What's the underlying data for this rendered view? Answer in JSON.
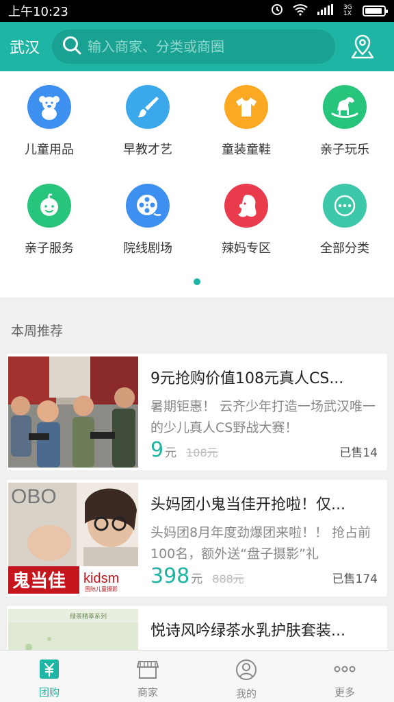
{
  "status_bar": {
    "time": "上午10:23",
    "network": "3G 1X"
  },
  "header": {
    "city": "武汉",
    "search_placeholder": "输入商家、分类或商圈",
    "location_icon": "location-pin-icon"
  },
  "categories": [
    {
      "label": "儿童用品",
      "icon": "teddy-bear-icon",
      "color": "#3d8ff0"
    },
    {
      "label": "早教才艺",
      "icon": "paintbrush-icon",
      "color": "#3aa8ea"
    },
    {
      "label": "童装童鞋",
      "icon": "shirt-icon",
      "color": "#fba823"
    },
    {
      "label": "亲子玩乐",
      "icon": "rocking-horse-icon",
      "color": "#27c47c"
    },
    {
      "label": "亲子服务",
      "icon": "baby-face-icon",
      "color": "#27c47c"
    },
    {
      "label": "院线剧场",
      "icon": "film-reel-icon",
      "color": "#3d8ff0"
    },
    {
      "label": "辣妈专区",
      "icon": "woman-profile-icon",
      "color": "#ea3b4d"
    },
    {
      "label": "全部分类",
      "icon": "more-dots-icon",
      "color": "#3cc7a8"
    }
  ],
  "section_title": "本周推荐",
  "deals": [
    {
      "title": "9元抢购价值108元真人CS...",
      "desc": "暑期钜惠！ 云齐少年打造一场武汉唯一的少儿真人CS野战大赛！",
      "price": "9",
      "unit": "元",
      "original": "108元",
      "sold": "已售14"
    },
    {
      "title": "头妈团小鬼当佳开抢啦！仅...",
      "desc": "头妈团8月年度劲爆团来啦！！ 抢占前100名，额外送“盘子摄影”礼",
      "price": "398",
      "unit": "元",
      "original": "888元",
      "sold": "已售174",
      "image_text": {
        "logo": "鬼当佳",
        "brand": "kidsm",
        "sub": "国际儿童摄影",
        "corner": "OBO"
      }
    },
    {
      "title": "悦诗风吟绿茶水乳护肤套装...",
      "desc": "",
      "price": "",
      "unit": "",
      "original": "",
      "sold": "",
      "image_text": {
        "label": "绿茶精萃系列"
      }
    }
  ],
  "tabs": [
    {
      "label": "团购",
      "icon": "yuan-tag-icon",
      "active": true
    },
    {
      "label": "商家",
      "icon": "storefront-icon",
      "active": false
    },
    {
      "label": "我的",
      "icon": "user-icon",
      "active": false
    },
    {
      "label": "更多",
      "icon": "more-dots-icon",
      "active": false
    }
  ],
  "colors": {
    "primary": "#1fb5a4",
    "search_bg": "#19a292"
  }
}
